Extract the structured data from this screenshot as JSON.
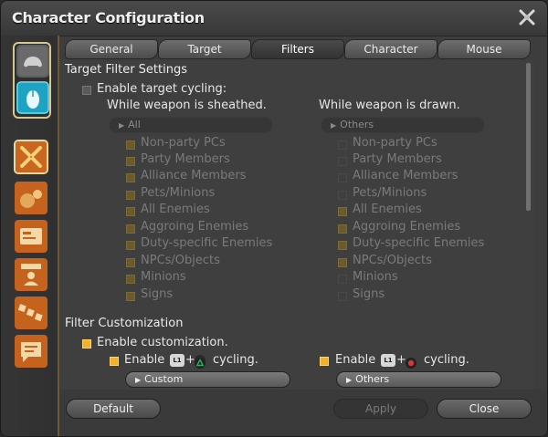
{
  "window": {
    "title": "Character Configuration"
  },
  "tabs": [
    {
      "label": "General"
    },
    {
      "label": "Target"
    },
    {
      "label": "Filters"
    },
    {
      "label": "Character"
    },
    {
      "label": "Mouse"
    }
  ],
  "active_tab": "Filters",
  "target_filter": {
    "heading": "Target Filter Settings",
    "enable_cycling_label": "Enable target cycling:",
    "sheathed": {
      "heading": "While weapon is sheathed.",
      "dropdown_value": "All",
      "items": [
        {
          "label": "Non-party PCs",
          "checked": true
        },
        {
          "label": "Party Members",
          "checked": true
        },
        {
          "label": "Alliance Members",
          "checked": true
        },
        {
          "label": "Pets/Minions",
          "checked": true
        },
        {
          "label": "All Enemies",
          "checked": true
        },
        {
          "label": "Aggroing Enemies",
          "checked": true
        },
        {
          "label": "Duty-specific Enemies",
          "checked": true
        },
        {
          "label": "NPCs/Objects",
          "checked": true
        },
        {
          "label": "Minions",
          "checked": true
        },
        {
          "label": "Signs",
          "checked": true
        }
      ]
    },
    "drawn": {
      "heading": "While weapon is drawn.",
      "dropdown_value": "Others",
      "items": [
        {
          "label": "Non-party PCs",
          "checked": false
        },
        {
          "label": "Party Members",
          "checked": false
        },
        {
          "label": "Alliance Members",
          "checked": false
        },
        {
          "label": "Pets/Minions",
          "checked": false
        },
        {
          "label": "All Enemies",
          "checked": true
        },
        {
          "label": "Aggroing Enemies",
          "checked": true
        },
        {
          "label": "Duty-specific Enemies",
          "checked": true
        },
        {
          "label": "NPCs/Objects",
          "checked": true
        },
        {
          "label": "Minions",
          "checked": false
        },
        {
          "label": "Signs",
          "checked": false
        }
      ]
    }
  },
  "filter_customization": {
    "heading": "Filter Customization",
    "enable_label": "Enable customization.",
    "left": {
      "enable_word": "Enable",
      "button_label": "L1",
      "plus": "+",
      "cycling_label": "cycling.",
      "dropdown_value": "Custom"
    },
    "right": {
      "enable_word": "Enable",
      "button_label": "L1",
      "plus": "+",
      "cycling_label": "cycling.",
      "dropdown_value": "Others"
    }
  },
  "footer": {
    "default_label": "Default",
    "apply_label": "Apply",
    "close_label": "Close"
  },
  "colors": {
    "accent": "#f0b22a",
    "rail_border": "#6e5a2e",
    "triangle_green": "#2fae5a",
    "circle_red": "#d23a3a"
  },
  "icons": {
    "close": "close-x-icon",
    "rail": [
      "gamepad-icon",
      "mouse-icon",
      "target-icon",
      "gear-bag-icon",
      "card-icon",
      "person-icon",
      "hotbar-icon",
      "chat-icon"
    ]
  }
}
